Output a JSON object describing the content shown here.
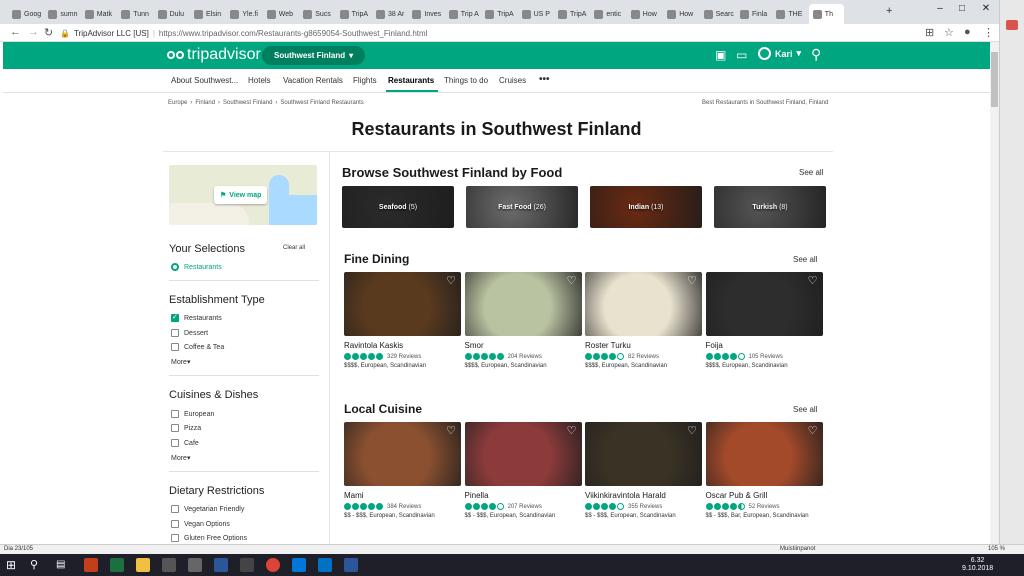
{
  "browser": {
    "tabs": [
      "Goog",
      "sumn",
      "Matk",
      "Tunn",
      "Dulu",
      "Elsin",
      "Yle.fi",
      "Web",
      "Sucs",
      "TripA",
      "38 Ar",
      "Inves",
      "Trip A",
      "TripA",
      "US P",
      "TripA",
      "entic",
      "How",
      "How",
      "Searc",
      "Finla",
      "THE",
      "Th"
    ],
    "address_site": "TripAdvisor LLC [US]",
    "address_url": "https://www.tripadvisor.com/Restaurants-g8659054-Southwest_Finland.html"
  },
  "header": {
    "logo_text": "tripadvisor",
    "geo_pill": "Southwest Finland",
    "user_name": "Kari"
  },
  "subnav": {
    "items": [
      "About Southwest...",
      "Hotels",
      "Vacation Rentals",
      "Flights",
      "Restaurants",
      "Things to do",
      "Cruises"
    ],
    "more": "•••"
  },
  "breadcrumbs": [
    "Europe",
    "Finland",
    "Southwest Finland",
    "Southwest Finland Restaurants"
  ],
  "crumb_right": "Best Restaurants in Southwest Finland, Finland",
  "page_title": "Restaurants in Southwest Finland",
  "sidebar": {
    "view_map": "View map",
    "your_selections": "Your Selections",
    "clear_all": "Clear all",
    "selection": "Restaurants",
    "establishment_type": "Establishment Type",
    "establishment_options": [
      "Restaurants",
      "Dessert",
      "Coffee & Tea"
    ],
    "establishment_more": "More",
    "cuisines": "Cuisines & Dishes",
    "cuisine_options": [
      "European",
      "Pizza",
      "Cafe"
    ],
    "cuisine_more": "More",
    "dietary": "Dietary Restrictions",
    "dietary_options": [
      "Vegetarian Friendly",
      "Vegan Options",
      "Gluten Free Options"
    ]
  },
  "browse": {
    "title": "Browse Southwest Finland by Food",
    "see_all": "See all",
    "tiles": [
      {
        "name": "Seafood",
        "count": "(5)",
        "color": "#2b2b2b"
      },
      {
        "name": "Fast Food",
        "count": "(26)",
        "color": "#6d6d6d"
      },
      {
        "name": "Indian",
        "count": "(13)",
        "color": "#6b2a12"
      },
      {
        "name": "Turkish",
        "count": "(8)",
        "color": "#555555"
      }
    ]
  },
  "fine_dining": {
    "title": "Fine Dining",
    "see_all": "See all",
    "cards": [
      {
        "name": "Ravintola Kaskis",
        "reviews": "329 Reviews",
        "meta": "$$$$, European, Scandinavian",
        "rating": 5,
        "color": "#5a3a1e"
      },
      {
        "name": "Smor",
        "reviews": "204 Reviews",
        "meta": "$$$$, European, Scandinavian",
        "rating": 5,
        "color": "#b9c2a1"
      },
      {
        "name": "Roster Turku",
        "reviews": "82 Reviews",
        "meta": "$$$$, European, Scandinavian",
        "rating": 4,
        "color": "#e9e2cf"
      },
      {
        "name": "Foija",
        "reviews": "105 Reviews",
        "meta": "$$$$, European, Scandinavian",
        "rating": 4,
        "color": "#2d2d2d"
      }
    ]
  },
  "local_cuisine": {
    "title": "Local Cuisine",
    "see_all": "See all",
    "cards": [
      {
        "name": "Mami",
        "reviews": "384 Reviews",
        "meta": "$$ - $$$, European, Scandinavian",
        "rating": 5,
        "color": "#8a5030"
      },
      {
        "name": "Pinella",
        "reviews": "207 Reviews",
        "meta": "$$ - $$$, European, Scandinavian",
        "rating": 4,
        "color": "#8c3b3b"
      },
      {
        "name": "Viikinkiravintola Harald",
        "reviews": "355 Reviews",
        "meta": "$$ - $$$, European, Scandinavian",
        "rating": 4,
        "color": "#3a3225"
      },
      {
        "name": "Oscar Pub & Grill",
        "reviews": "52 Reviews",
        "meta": "$$ - $$$, Bar, European, Scandinavian",
        "rating": 4.5,
        "color": "#a24a2a"
      }
    ]
  },
  "status_bar": {
    "left": "Dia 23/105",
    "right": "Muistiinpanot",
    "zoom": "105 %"
  },
  "taskbar": {
    "time": "6.32",
    "date": "9.10.2018"
  },
  "colors": {
    "brand": "#00a680"
  }
}
